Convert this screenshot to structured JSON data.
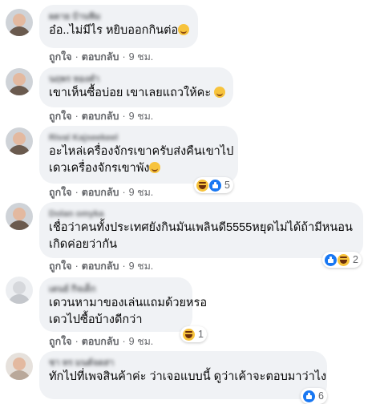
{
  "comments": [
    {
      "author": "ผดาย บ้านพิม",
      "text_lines": [
        "อ๋อ..ไม่มีไร หยิบออกกินต่อ"
      ],
      "trailing_emoji": "smiling-face-icon",
      "like_label": "ถูกใจ",
      "reply_label": "ตอบกลับ",
      "time": "9 ชม.",
      "reactions": null
    },
    {
      "author": "นฤพร ทองคำ",
      "text_lines": [
        "เขาเห็นซื้อบ่อย เขาเลยแถวให้คะ"
      ],
      "trailing_emoji": "smiling-face-icon",
      "like_label": "ถูกใจ",
      "reply_label": "ตอบกลับ",
      "time": "9 ชม.",
      "reactions": null
    },
    {
      "author": "Rival Kajseekeel",
      "text_lines": [
        "อะไหล่เครื่องจักรเขาครับส่งคืนเขาไป",
        "เดวเครื่องจักรเขาพัง"
      ],
      "trailing_emoji": "smiling-face-icon",
      "like_label": "ถูกใจ",
      "reply_label": "ตอบกลับ",
      "time": "9 ชม.",
      "reactions": {
        "icons": [
          "haha-reaction-icon",
          "like-reaction-icon"
        ],
        "count": "5"
      }
    },
    {
      "author": "Dolan omyka",
      "text_lines": [
        "เชื่อว่าคนทั้งประเทศยังกินมันเพลินดี5555หยุดไม่ได้ถ้ามีหนอน",
        "เกิดค่อยว่ากัน"
      ],
      "trailing_emoji": null,
      "like_label": "ถูกใจ",
      "reply_label": "ตอบกลับ",
      "time": "9 ชม.",
      "reactions": {
        "icons": [
          "like-reaction-icon",
          "haha-reaction-icon"
        ],
        "count": "2"
      }
    },
    {
      "author": "เดนย์ กิจเด็ก",
      "text_lines": [
        "เดวนหามาของเล่นแถมด้วยหรอ",
        "เดวไปซื้อบ้างดีกว่า"
      ],
      "trailing_emoji": null,
      "like_label": "ถูกใจ",
      "reply_label": "ตอบกลับ",
      "time": "9 ชม.",
      "reactions": {
        "icons": [
          "haha-reaction-icon"
        ],
        "count": "1"
      }
    },
    {
      "author": "ชา ทร มนต์จดสา",
      "text_lines": [
        "ทักไปที่เพจสินค้าค่ะ ว่าเจอแบบนี้ ดูว่าเค้าจะตอบมาว่าไง"
      ],
      "trailing_emoji": null,
      "like_label": "",
      "reply_label": "",
      "time": "",
      "reactions": {
        "icons": [
          "like-reaction-icon"
        ],
        "count": "6"
      }
    }
  ],
  "colors": {
    "bubble_bg": "#f0f2f5",
    "secondary_text": "#65676b",
    "like_blue": "#1877f2",
    "haha_yellow": "#f7c33c"
  }
}
